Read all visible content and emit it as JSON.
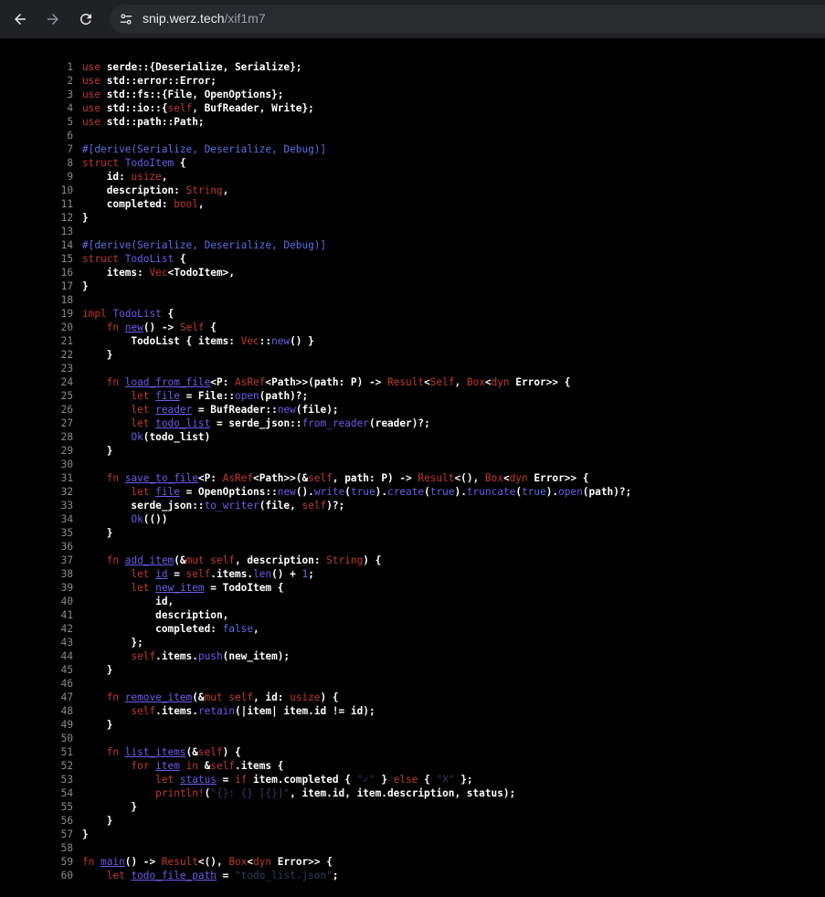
{
  "browser": {
    "url_host": "snip.werz.tech",
    "url_path": "/xif1m7"
  },
  "colors": {
    "keyword": "#c0392b",
    "type": "#6c5ce7",
    "attribute": "#5b6ee1",
    "string": "#2e3d5f",
    "line_number": "#8b8b8b",
    "background": "#000000"
  },
  "code_lines": [
    {
      "n": "1",
      "tokens": [
        [
          "k",
          "use"
        ],
        [
          "p",
          " serde::{Deserialize, Serialize};"
        ]
      ]
    },
    {
      "n": "2",
      "tokens": [
        [
          "k",
          "use"
        ],
        [
          "p",
          " std::error::Error;"
        ]
      ]
    },
    {
      "n": "3",
      "tokens": [
        [
          "k",
          "use"
        ],
        [
          "p",
          " std::fs::{File, OpenOptions};"
        ]
      ]
    },
    {
      "n": "4",
      "tokens": [
        [
          "k",
          "use"
        ],
        [
          "p",
          " std::io::{"
        ],
        [
          "s",
          "self"
        ],
        [
          "p",
          ", BufReader, Write};"
        ]
      ]
    },
    {
      "n": "5",
      "tokens": [
        [
          "k",
          "use"
        ],
        [
          "p",
          " std::path::Path;"
        ]
      ]
    },
    {
      "n": "6",
      "tokens": []
    },
    {
      "n": "7",
      "tokens": [
        [
          "a",
          "#[derive(Serialize, Deserialize, Debug)]"
        ]
      ]
    },
    {
      "n": "8",
      "tokens": [
        [
          "k",
          "struct"
        ],
        [
          "p",
          " "
        ],
        [
          "t",
          "TodoItem"
        ],
        [
          "p",
          " {"
        ]
      ]
    },
    {
      "n": "9",
      "tokens": [
        [
          "p",
          "    id: "
        ],
        [
          "k",
          "usize"
        ],
        [
          "p",
          ","
        ]
      ]
    },
    {
      "n": "10",
      "tokens": [
        [
          "p",
          "    description: "
        ],
        [
          "k",
          "String"
        ],
        [
          "p",
          ","
        ]
      ]
    },
    {
      "n": "11",
      "tokens": [
        [
          "p",
          "    completed: "
        ],
        [
          "k",
          "bool"
        ],
        [
          "p",
          ","
        ]
      ]
    },
    {
      "n": "12",
      "tokens": [
        [
          "p",
          "}"
        ]
      ]
    },
    {
      "n": "13",
      "tokens": []
    },
    {
      "n": "14",
      "tokens": [
        [
          "a",
          "#[derive(Serialize, Deserialize, Debug)]"
        ]
      ]
    },
    {
      "n": "15",
      "tokens": [
        [
          "k",
          "struct"
        ],
        [
          "p",
          " "
        ],
        [
          "t",
          "TodoList"
        ],
        [
          "p",
          " {"
        ]
      ]
    },
    {
      "n": "16",
      "tokens": [
        [
          "p",
          "    items: "
        ],
        [
          "k",
          "Vec"
        ],
        [
          "p",
          "<TodoItem>,"
        ]
      ]
    },
    {
      "n": "17",
      "tokens": [
        [
          "p",
          "}"
        ]
      ]
    },
    {
      "n": "18",
      "tokens": []
    },
    {
      "n": "19",
      "tokens": [
        [
          "k",
          "impl"
        ],
        [
          "p",
          " "
        ],
        [
          "t",
          "TodoList"
        ],
        [
          "p",
          " {"
        ]
      ]
    },
    {
      "n": "20",
      "tokens": [
        [
          "p",
          "    "
        ],
        [
          "k",
          "fn"
        ],
        [
          "p",
          " "
        ],
        [
          "f",
          "new"
        ],
        [
          "p",
          "() -> "
        ],
        [
          "k",
          "Self"
        ],
        [
          "p",
          " {"
        ]
      ]
    },
    {
      "n": "21",
      "tokens": [
        [
          "p",
          "        TodoList { items: "
        ],
        [
          "k",
          "Vec"
        ],
        [
          "p",
          "::"
        ],
        [
          "c",
          "new"
        ],
        [
          "p",
          "() }"
        ]
      ]
    },
    {
      "n": "22",
      "tokens": [
        [
          "p",
          "    }"
        ]
      ]
    },
    {
      "n": "23",
      "tokens": []
    },
    {
      "n": "24",
      "tokens": [
        [
          "p",
          "    "
        ],
        [
          "k",
          "fn"
        ],
        [
          "p",
          " "
        ],
        [
          "f",
          "load_from_file"
        ],
        [
          "p",
          "<P: "
        ],
        [
          "k",
          "AsRef"
        ],
        [
          "p",
          "<Path>>(path: P) -> "
        ],
        [
          "k",
          "Result"
        ],
        [
          "p",
          "<"
        ],
        [
          "k",
          "Self"
        ],
        [
          "p",
          ", "
        ],
        [
          "k",
          "Box"
        ],
        [
          "p",
          "<"
        ],
        [
          "k",
          "dyn"
        ],
        [
          "p",
          " Error>> {"
        ]
      ]
    },
    {
      "n": "25",
      "tokens": [
        [
          "p",
          "        "
        ],
        [
          "k",
          "let"
        ],
        [
          "p",
          " "
        ],
        [
          "v",
          "file"
        ],
        [
          "p",
          " = File::"
        ],
        [
          "c",
          "open"
        ],
        [
          "p",
          "(path)?;"
        ]
      ]
    },
    {
      "n": "26",
      "tokens": [
        [
          "p",
          "        "
        ],
        [
          "k",
          "let"
        ],
        [
          "p",
          " "
        ],
        [
          "v",
          "reader"
        ],
        [
          "p",
          " = BufReader::"
        ],
        [
          "c",
          "new"
        ],
        [
          "p",
          "(file);"
        ]
      ]
    },
    {
      "n": "27",
      "tokens": [
        [
          "p",
          "        "
        ],
        [
          "k",
          "let"
        ],
        [
          "p",
          " "
        ],
        [
          "v",
          "todo_list"
        ],
        [
          "p",
          " = serde_json::"
        ],
        [
          "c",
          "from_reader"
        ],
        [
          "p",
          "(reader)?;"
        ]
      ]
    },
    {
      "n": "28",
      "tokens": [
        [
          "p",
          "        "
        ],
        [
          "c",
          "Ok"
        ],
        [
          "p",
          "(todo_list)"
        ]
      ]
    },
    {
      "n": "29",
      "tokens": [
        [
          "p",
          "    }"
        ]
      ]
    },
    {
      "n": "30",
      "tokens": []
    },
    {
      "n": "31",
      "tokens": [
        [
          "p",
          "    "
        ],
        [
          "k",
          "fn"
        ],
        [
          "p",
          " "
        ],
        [
          "f",
          "save_to_file"
        ],
        [
          "p",
          "<P: "
        ],
        [
          "k",
          "AsRef"
        ],
        [
          "p",
          "<Path>>(&"
        ],
        [
          "s",
          "self"
        ],
        [
          "p",
          ", path: P) -> "
        ],
        [
          "k",
          "Result"
        ],
        [
          "p",
          "<(), "
        ],
        [
          "k",
          "Box"
        ],
        [
          "p",
          "<"
        ],
        [
          "k",
          "dyn"
        ],
        [
          "p",
          " Error>> {"
        ]
      ]
    },
    {
      "n": "32",
      "tokens": [
        [
          "p",
          "        "
        ],
        [
          "k",
          "let"
        ],
        [
          "p",
          " "
        ],
        [
          "v",
          "file"
        ],
        [
          "p",
          " = OpenOptions::"
        ],
        [
          "c",
          "new"
        ],
        [
          "p",
          "()."
        ],
        [
          "c",
          "write"
        ],
        [
          "p",
          "("
        ],
        [
          "n",
          "true"
        ],
        [
          "p",
          ")."
        ],
        [
          "c",
          "create"
        ],
        [
          "p",
          "("
        ],
        [
          "n",
          "true"
        ],
        [
          "p",
          ")."
        ],
        [
          "c",
          "truncate"
        ],
        [
          "p",
          "("
        ],
        [
          "n",
          "true"
        ],
        [
          "p",
          ")."
        ],
        [
          "c",
          "open"
        ],
        [
          "p",
          "(path)?;"
        ]
      ]
    },
    {
      "n": "33",
      "tokens": [
        [
          "p",
          "        serde_json::"
        ],
        [
          "c",
          "to_writer"
        ],
        [
          "p",
          "(file, "
        ],
        [
          "s",
          "self"
        ],
        [
          "p",
          ")?;"
        ]
      ]
    },
    {
      "n": "34",
      "tokens": [
        [
          "p",
          "        "
        ],
        [
          "c",
          "Ok"
        ],
        [
          "p",
          "(())"
        ]
      ]
    },
    {
      "n": "35",
      "tokens": [
        [
          "p",
          "    }"
        ]
      ]
    },
    {
      "n": "36",
      "tokens": []
    },
    {
      "n": "37",
      "tokens": [
        [
          "p",
          "    "
        ],
        [
          "k",
          "fn"
        ],
        [
          "p",
          " "
        ],
        [
          "f",
          "add_item"
        ],
        [
          "p",
          "(&"
        ],
        [
          "k",
          "mut"
        ],
        [
          "p",
          " "
        ],
        [
          "s",
          "self"
        ],
        [
          "p",
          ", description: "
        ],
        [
          "k",
          "String"
        ],
        [
          "p",
          ") {"
        ]
      ]
    },
    {
      "n": "38",
      "tokens": [
        [
          "p",
          "        "
        ],
        [
          "k",
          "let"
        ],
        [
          "p",
          " "
        ],
        [
          "v",
          "id"
        ],
        [
          "p",
          " = "
        ],
        [
          "s",
          "self"
        ],
        [
          "p",
          ".items."
        ],
        [
          "c",
          "len"
        ],
        [
          "p",
          "() + "
        ],
        [
          "n",
          "1"
        ],
        [
          "p",
          ";"
        ]
      ]
    },
    {
      "n": "39",
      "tokens": [
        [
          "p",
          "        "
        ],
        [
          "k",
          "let"
        ],
        [
          "p",
          " "
        ],
        [
          "v",
          "new_item"
        ],
        [
          "p",
          " = TodoItem {"
        ]
      ]
    },
    {
      "n": "40",
      "tokens": [
        [
          "p",
          "            id,"
        ]
      ]
    },
    {
      "n": "41",
      "tokens": [
        [
          "p",
          "            description,"
        ]
      ]
    },
    {
      "n": "42",
      "tokens": [
        [
          "p",
          "            completed: "
        ],
        [
          "n",
          "false"
        ],
        [
          "p",
          ","
        ]
      ]
    },
    {
      "n": "43",
      "tokens": [
        [
          "p",
          "        };"
        ]
      ]
    },
    {
      "n": "44",
      "tokens": [
        [
          "p",
          "        "
        ],
        [
          "s",
          "self"
        ],
        [
          "p",
          ".items."
        ],
        [
          "c",
          "push"
        ],
        [
          "p",
          "(new_item);"
        ]
      ]
    },
    {
      "n": "45",
      "tokens": [
        [
          "p",
          "    }"
        ]
      ]
    },
    {
      "n": "46",
      "tokens": []
    },
    {
      "n": "47",
      "tokens": [
        [
          "p",
          "    "
        ],
        [
          "k",
          "fn"
        ],
        [
          "p",
          " "
        ],
        [
          "f",
          "remove_item"
        ],
        [
          "p",
          "(&"
        ],
        [
          "k",
          "mut"
        ],
        [
          "p",
          " "
        ],
        [
          "s",
          "self"
        ],
        [
          "p",
          ", id: "
        ],
        [
          "k",
          "usize"
        ],
        [
          "p",
          ") {"
        ]
      ]
    },
    {
      "n": "48",
      "tokens": [
        [
          "p",
          "        "
        ],
        [
          "s",
          "self"
        ],
        [
          "p",
          ".items."
        ],
        [
          "c",
          "retain"
        ],
        [
          "p",
          "(|item| item.id != id);"
        ]
      ]
    },
    {
      "n": "49",
      "tokens": [
        [
          "p",
          "    }"
        ]
      ]
    },
    {
      "n": "50",
      "tokens": []
    },
    {
      "n": "51",
      "tokens": [
        [
          "p",
          "    "
        ],
        [
          "k",
          "fn"
        ],
        [
          "p",
          " "
        ],
        [
          "f",
          "list_items"
        ],
        [
          "p",
          "(&"
        ],
        [
          "s",
          "self"
        ],
        [
          "p",
          ") {"
        ]
      ]
    },
    {
      "n": "52",
      "tokens": [
        [
          "p",
          "        "
        ],
        [
          "k",
          "for"
        ],
        [
          "p",
          " "
        ],
        [
          "v",
          "item"
        ],
        [
          "p",
          " "
        ],
        [
          "k",
          "in"
        ],
        [
          "p",
          " &"
        ],
        [
          "s",
          "self"
        ],
        [
          "p",
          ".items {"
        ]
      ]
    },
    {
      "n": "53",
      "tokens": [
        [
          "p",
          "            "
        ],
        [
          "k",
          "let"
        ],
        [
          "p",
          " "
        ],
        [
          "v",
          "status"
        ],
        [
          "p",
          " = "
        ],
        [
          "k",
          "if"
        ],
        [
          "p",
          " item.completed { "
        ],
        [
          "r",
          "\"✓\""
        ],
        [
          "p",
          " } "
        ],
        [
          "k",
          "else"
        ],
        [
          "p",
          " { "
        ],
        [
          "r",
          "\"X\""
        ],
        [
          "p",
          " };"
        ]
      ]
    },
    {
      "n": "54",
      "tokens": [
        [
          "p",
          "            "
        ],
        [
          "k",
          "println!"
        ],
        [
          "p",
          "("
        ],
        [
          "r",
          "\"{}: {} [{}]\""
        ],
        [
          "p",
          ", item.id, item.description, status);"
        ]
      ]
    },
    {
      "n": "55",
      "tokens": [
        [
          "p",
          "        }"
        ]
      ]
    },
    {
      "n": "56",
      "tokens": [
        [
          "p",
          "    }"
        ]
      ]
    },
    {
      "n": "57",
      "tokens": [
        [
          "p",
          "}"
        ]
      ]
    },
    {
      "n": "58",
      "tokens": []
    },
    {
      "n": "59",
      "tokens": [
        [
          "k",
          "fn"
        ],
        [
          "p",
          " "
        ],
        [
          "f",
          "main"
        ],
        [
          "p",
          "() -> "
        ],
        [
          "k",
          "Result"
        ],
        [
          "p",
          "<(), "
        ],
        [
          "k",
          "Box"
        ],
        [
          "p",
          "<"
        ],
        [
          "k",
          "dyn"
        ],
        [
          "p",
          " Error>> {"
        ]
      ]
    },
    {
      "n": "60",
      "tokens": [
        [
          "p",
          "    "
        ],
        [
          "k",
          "let"
        ],
        [
          "p",
          " "
        ],
        [
          "v",
          "todo_file_path"
        ],
        [
          "p",
          " = "
        ],
        [
          "r",
          "\"todo_list.json\""
        ],
        [
          "p",
          ";"
        ]
      ]
    }
  ]
}
